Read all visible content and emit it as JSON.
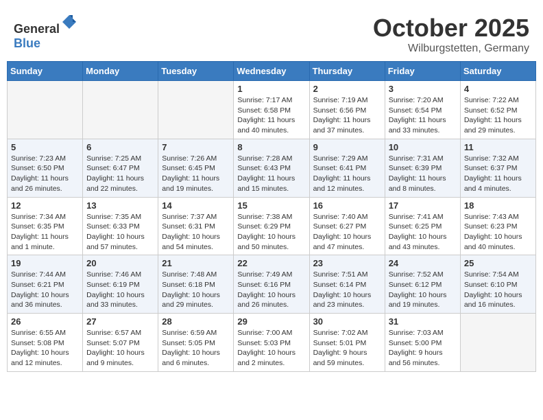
{
  "header": {
    "logo_general": "General",
    "logo_blue": "Blue",
    "month": "October 2025",
    "location": "Wilburgstetten, Germany"
  },
  "weekdays": [
    "Sunday",
    "Monday",
    "Tuesday",
    "Wednesday",
    "Thursday",
    "Friday",
    "Saturday"
  ],
  "weeks": [
    [
      {
        "day": "",
        "info": ""
      },
      {
        "day": "",
        "info": ""
      },
      {
        "day": "",
        "info": ""
      },
      {
        "day": "1",
        "info": "Sunrise: 7:17 AM\nSunset: 6:58 PM\nDaylight: 11 hours\nand 40 minutes."
      },
      {
        "day": "2",
        "info": "Sunrise: 7:19 AM\nSunset: 6:56 PM\nDaylight: 11 hours\nand 37 minutes."
      },
      {
        "day": "3",
        "info": "Sunrise: 7:20 AM\nSunset: 6:54 PM\nDaylight: 11 hours\nand 33 minutes."
      },
      {
        "day": "4",
        "info": "Sunrise: 7:22 AM\nSunset: 6:52 PM\nDaylight: 11 hours\nand 29 minutes."
      }
    ],
    [
      {
        "day": "5",
        "info": "Sunrise: 7:23 AM\nSunset: 6:50 PM\nDaylight: 11 hours\nand 26 minutes."
      },
      {
        "day": "6",
        "info": "Sunrise: 7:25 AM\nSunset: 6:47 PM\nDaylight: 11 hours\nand 22 minutes."
      },
      {
        "day": "7",
        "info": "Sunrise: 7:26 AM\nSunset: 6:45 PM\nDaylight: 11 hours\nand 19 minutes."
      },
      {
        "day": "8",
        "info": "Sunrise: 7:28 AM\nSunset: 6:43 PM\nDaylight: 11 hours\nand 15 minutes."
      },
      {
        "day": "9",
        "info": "Sunrise: 7:29 AM\nSunset: 6:41 PM\nDaylight: 11 hours\nand 12 minutes."
      },
      {
        "day": "10",
        "info": "Sunrise: 7:31 AM\nSunset: 6:39 PM\nDaylight: 11 hours\nand 8 minutes."
      },
      {
        "day": "11",
        "info": "Sunrise: 7:32 AM\nSunset: 6:37 PM\nDaylight: 11 hours\nand 4 minutes."
      }
    ],
    [
      {
        "day": "12",
        "info": "Sunrise: 7:34 AM\nSunset: 6:35 PM\nDaylight: 11 hours\nand 1 minute."
      },
      {
        "day": "13",
        "info": "Sunrise: 7:35 AM\nSunset: 6:33 PM\nDaylight: 10 hours\nand 57 minutes."
      },
      {
        "day": "14",
        "info": "Sunrise: 7:37 AM\nSunset: 6:31 PM\nDaylight: 10 hours\nand 54 minutes."
      },
      {
        "day": "15",
        "info": "Sunrise: 7:38 AM\nSunset: 6:29 PM\nDaylight: 10 hours\nand 50 minutes."
      },
      {
        "day": "16",
        "info": "Sunrise: 7:40 AM\nSunset: 6:27 PM\nDaylight: 10 hours\nand 47 minutes."
      },
      {
        "day": "17",
        "info": "Sunrise: 7:41 AM\nSunset: 6:25 PM\nDaylight: 10 hours\nand 43 minutes."
      },
      {
        "day": "18",
        "info": "Sunrise: 7:43 AM\nSunset: 6:23 PM\nDaylight: 10 hours\nand 40 minutes."
      }
    ],
    [
      {
        "day": "19",
        "info": "Sunrise: 7:44 AM\nSunset: 6:21 PM\nDaylight: 10 hours\nand 36 minutes."
      },
      {
        "day": "20",
        "info": "Sunrise: 7:46 AM\nSunset: 6:19 PM\nDaylight: 10 hours\nand 33 minutes."
      },
      {
        "day": "21",
        "info": "Sunrise: 7:48 AM\nSunset: 6:18 PM\nDaylight: 10 hours\nand 29 minutes."
      },
      {
        "day": "22",
        "info": "Sunrise: 7:49 AM\nSunset: 6:16 PM\nDaylight: 10 hours\nand 26 minutes."
      },
      {
        "day": "23",
        "info": "Sunrise: 7:51 AM\nSunset: 6:14 PM\nDaylight: 10 hours\nand 23 minutes."
      },
      {
        "day": "24",
        "info": "Sunrise: 7:52 AM\nSunset: 6:12 PM\nDaylight: 10 hours\nand 19 minutes."
      },
      {
        "day": "25",
        "info": "Sunrise: 7:54 AM\nSunset: 6:10 PM\nDaylight: 10 hours\nand 16 minutes."
      }
    ],
    [
      {
        "day": "26",
        "info": "Sunrise: 6:55 AM\nSunset: 5:08 PM\nDaylight: 10 hours\nand 12 minutes."
      },
      {
        "day": "27",
        "info": "Sunrise: 6:57 AM\nSunset: 5:07 PM\nDaylight: 10 hours\nand 9 minutes."
      },
      {
        "day": "28",
        "info": "Sunrise: 6:59 AM\nSunset: 5:05 PM\nDaylight: 10 hours\nand 6 minutes."
      },
      {
        "day": "29",
        "info": "Sunrise: 7:00 AM\nSunset: 5:03 PM\nDaylight: 10 hours\nand 2 minutes."
      },
      {
        "day": "30",
        "info": "Sunrise: 7:02 AM\nSunset: 5:01 PM\nDaylight: 9 hours\nand 59 minutes."
      },
      {
        "day": "31",
        "info": "Sunrise: 7:03 AM\nSunset: 5:00 PM\nDaylight: 9 hours\nand 56 minutes."
      },
      {
        "day": "",
        "info": ""
      }
    ]
  ]
}
